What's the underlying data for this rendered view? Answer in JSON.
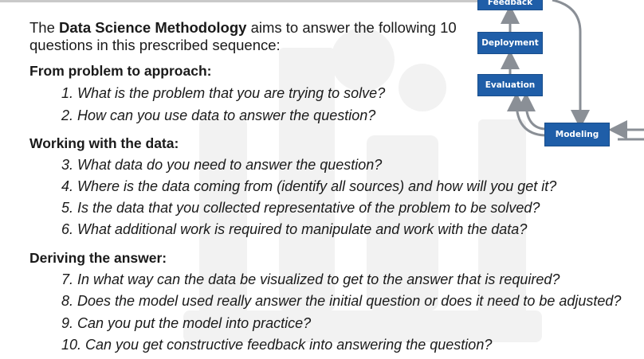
{
  "intro": {
    "before": "The ",
    "emphasis": "Data Science Methodology",
    "after": " aims to answer the following 10 questions in this prescribed sequence:"
  },
  "sections": [
    {
      "heading": "From problem to approach:",
      "questions": [
        "1. What is the problem that you are trying to solve?",
        "2. How can you use data to answer the question?"
      ]
    },
    {
      "heading": "Working with the data:",
      "questions": [
        "3. What data do you need to answer the question?",
        "4. Where is the data coming from (identify all sources) and how will you get it?",
        "5. Is the data that you collected representative of the problem to be solved?",
        "6. What additional work is required to manipulate and work with the data?"
      ]
    },
    {
      "heading": "Deriving the answer:",
      "questions": [
        "7. In what way can the data be visualized to get to the answer that is required?",
        "8. Does the model used really answer the initial question or does it need to be adjusted?",
        "9. Can you put the model into practice?",
        "10. Can you get constructive feedback into answering the question?"
      ]
    }
  ],
  "diagram": {
    "feedback": "Feedback",
    "deployment": "Deployment",
    "evaluation": "Evaluation",
    "modeling": "Modeling"
  },
  "colors": {
    "box": "#1f5ea8",
    "arrow": "#8a8f96",
    "watermark": "#f1f1f1"
  }
}
